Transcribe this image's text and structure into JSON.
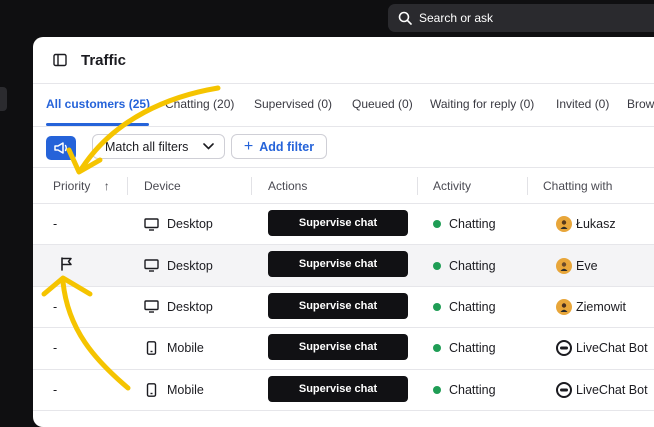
{
  "search": {
    "label": "Search or ask"
  },
  "panel": {
    "title": "Traffic"
  },
  "tabs": [
    {
      "label": "All customers (25)",
      "active": true
    },
    {
      "label": "Chatting (20)"
    },
    {
      "label": "Supervised (0)"
    },
    {
      "label": "Queued (0)"
    },
    {
      "label": "Waiting for reply (0)"
    },
    {
      "label": "Invited (0)"
    },
    {
      "label": "Brow"
    }
  ],
  "filters": {
    "match_label": "Match all filters",
    "add_filter_label": "Add filter"
  },
  "table": {
    "headers": {
      "priority": "Priority",
      "device": "Device",
      "actions": "Actions",
      "activity": "Activity",
      "chatting_with": "Chatting with"
    },
    "rows": [
      {
        "priority": "-",
        "device": "Desktop",
        "device_icon": "desktop-icon",
        "action": "Supervise chat",
        "activity": "Chatting",
        "agent": "Łukasz",
        "agent_icon": "avatar"
      },
      {
        "priority": "",
        "priority_icon": "flag-icon",
        "device": "Desktop",
        "device_icon": "desktop-icon",
        "action": "Supervise chat",
        "activity": "Chatting",
        "agent": "Eve",
        "agent_icon": "avatar",
        "highlighted": true
      },
      {
        "priority": "-",
        "device": "Desktop",
        "device_icon": "desktop-icon",
        "action": "Supervise chat",
        "activity": "Chatting",
        "agent": "Ziemowit",
        "agent_icon": "avatar"
      },
      {
        "priority": "-",
        "device": "Mobile",
        "device_icon": "mobile-icon",
        "action": "Supervise chat",
        "activity": "Chatting",
        "agent": "LiveChat Bot",
        "agent_icon": "bot-icon"
      },
      {
        "priority": "-",
        "device": "Mobile",
        "device_icon": "mobile-icon",
        "action": "Supervise chat",
        "activity": "Chatting",
        "agent": "LiveChat Bot",
        "agent_icon": "bot-icon"
      }
    ]
  },
  "colors": {
    "accent": "#2563d9",
    "status_green": "#1f9d55",
    "annotation": "#f5c400",
    "button": "#111114"
  }
}
